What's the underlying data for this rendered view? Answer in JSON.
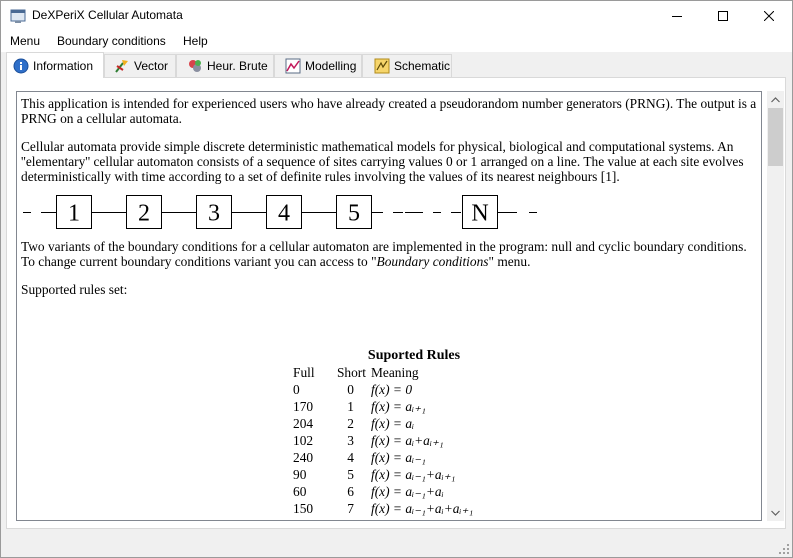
{
  "window": {
    "title": "DeXPeriX Cellular Automata",
    "icon": "app-window-icon",
    "controls": {
      "minimize": "—",
      "maximize": "☐",
      "close": "✕"
    }
  },
  "menu": [
    "Menu",
    "Boundary conditions",
    "Help"
  ],
  "tabs": [
    {
      "label": "Information",
      "icon": "info-icon",
      "active": true
    },
    {
      "label": "Vector",
      "icon": "vector-icon",
      "active": false
    },
    {
      "label": "Heur. Brute",
      "icon": "heur-brute-icon",
      "active": false
    },
    {
      "label": "Modelling",
      "icon": "modelling-icon",
      "active": false
    },
    {
      "label": "Schematic",
      "icon": "schematic-icon",
      "active": false
    }
  ],
  "info": {
    "p1": "This application is intended for experienced users who have already created a pseudorandom number generators (PRNG). The output is a PRNG on a cellular automata.",
    "p2": "Cellular automata provide simple discrete deterministic mathematical models for physical, biological and computational systems. An ''elementary'' cellular automaton consists of a sequence of sites carrying values 0 or 1 arranged on a line. The value at each site evolves deterministically with time according to a set of definite rules involving the values of its nearest neighbours [1].",
    "diagram_cells": [
      "1",
      "2",
      "3",
      "4",
      "5",
      "N"
    ],
    "p3_before": "Two variants of the boundary conditions for a cellular automaton are implemented in the program: null and cyclic boundary conditions. To change current boundary conditions variant you can access to \"",
    "p3_italic": "Boundary conditions",
    "p3_after": "\" menu.",
    "p4": "Supported rules set:"
  },
  "rules": {
    "title": "Suported Rules",
    "headers": {
      "full": "Full",
      "short": "Short",
      "meaning": "Meaning"
    },
    "rows": [
      {
        "full": "0",
        "short": "0",
        "meaning": "f(x) = 0"
      },
      {
        "full": "170",
        "short": "1",
        "meaning": "f(x) = aᵢ₊₁"
      },
      {
        "full": "204",
        "short": "2",
        "meaning": "f(x) = aᵢ"
      },
      {
        "full": "102",
        "short": "3",
        "meaning": "f(x) = aᵢ+aᵢ₊₁"
      },
      {
        "full": "240",
        "short": "4",
        "meaning": "f(x) = aᵢ₋₁"
      },
      {
        "full": "90",
        "short": "5",
        "meaning": "f(x) = aᵢ₋₁+aᵢ₊₁"
      },
      {
        "full": "60",
        "short": "6",
        "meaning": "f(x) = aᵢ₋₁+aᵢ"
      },
      {
        "full": "150",
        "short": "7",
        "meaning": "f(x) = aᵢ₋₁+aᵢ+aᵢ₊₁"
      }
    ]
  },
  "colors": {
    "accent": "#0078d7",
    "border": "#828790",
    "tab_border": "#d9d9d9"
  }
}
